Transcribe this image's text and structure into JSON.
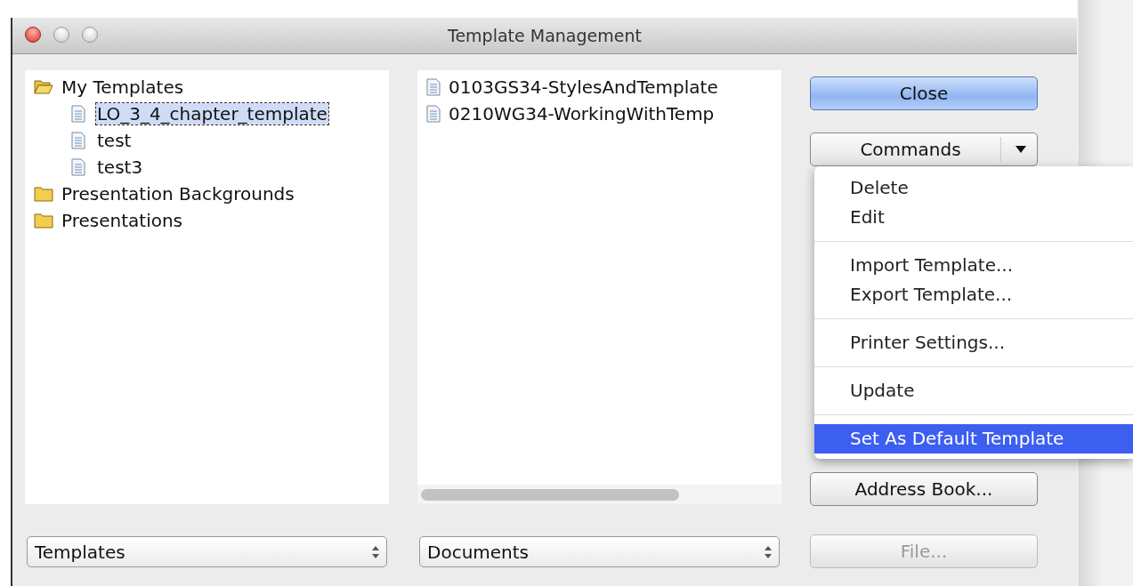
{
  "window": {
    "title": "Template Management"
  },
  "tree": [
    {
      "label": "My Templates",
      "kind": "folder",
      "expanded": true,
      "selected": false,
      "children": [
        {
          "label": "LO_3_4_chapter_template",
          "kind": "document",
          "selected": true
        },
        {
          "label": "test",
          "kind": "document",
          "selected": false
        },
        {
          "label": "test3",
          "kind": "document",
          "selected": false
        }
      ]
    },
    {
      "label": "Presentation Backgrounds",
      "kind": "folder",
      "expanded": false,
      "selected": false
    },
    {
      "label": "Presentations",
      "kind": "folder",
      "expanded": false,
      "selected": false
    }
  ],
  "documents": [
    {
      "label": "0103GS34-StylesAndTemplate"
    },
    {
      "label": "0210WG34-WorkingWithTemp"
    }
  ],
  "buttons": [
    {
      "label": "Close",
      "kind": "default",
      "disabled": false
    },
    {
      "label": "Commands",
      "kind": "menu",
      "disabled": false
    },
    {
      "label": "Address Book...",
      "kind": "normal",
      "disabled": false
    },
    {
      "label": "File...",
      "kind": "normal",
      "disabled": true
    }
  ],
  "left_select": {
    "value": "Templates"
  },
  "right_select": {
    "value": "Documents"
  },
  "menu": [
    {
      "kind": "item",
      "label": "Delete",
      "selected": false
    },
    {
      "kind": "item",
      "label": "Edit",
      "selected": false
    },
    {
      "kind": "separator"
    },
    {
      "kind": "item",
      "label": "Import Template...",
      "selected": false
    },
    {
      "kind": "item",
      "label": "Export Template...",
      "selected": false
    },
    {
      "kind": "separator"
    },
    {
      "kind": "item",
      "label": "Printer Settings...",
      "selected": false
    },
    {
      "kind": "separator"
    },
    {
      "kind": "item",
      "label": "Update",
      "selected": false
    },
    {
      "kind": "separator"
    },
    {
      "kind": "item",
      "label": "Set As Default Template",
      "selected": true
    }
  ]
}
